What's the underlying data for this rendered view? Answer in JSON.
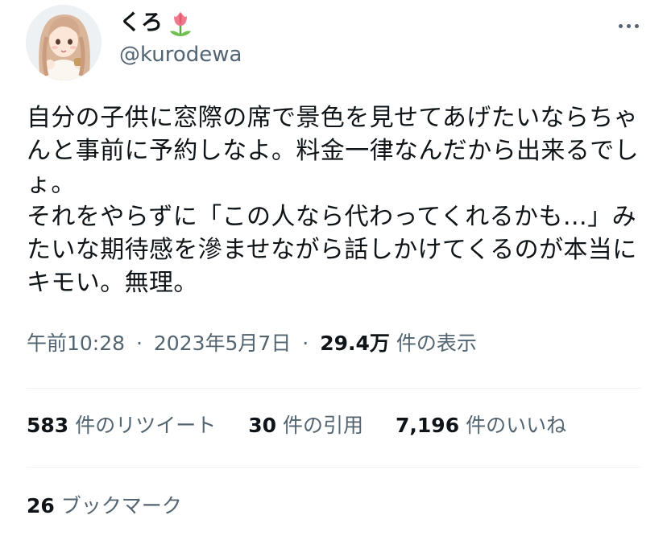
{
  "author": {
    "display_name": "くろ",
    "name_emoji": "tulip-emoji",
    "handle": "@kurodewa",
    "avatar": "avatar-illustration"
  },
  "menu": {
    "icon": "more-horizontal-icon"
  },
  "tweet": {
    "lines": [
      "自分の子供に窓際の席で景色を見せてあげたいならちゃ",
      "んと事前に予約しなよ。料金一律なんだから出来るでし",
      "ょ。",
      "それをやらずに「この人なら代わってくれるかも…」み",
      "たいな期待感を滲ませながら話しかけてくるのが本当に",
      "キモい。無理。"
    ]
  },
  "meta": {
    "time": "午前10:28",
    "separator": "·",
    "date": "2023年5月7日",
    "views_count": "29.4万",
    "views_label": "件の表示"
  },
  "stats": {
    "retweets": {
      "count": "583",
      "label": "件のリツイート"
    },
    "quotes": {
      "count": "30",
      "label": "件の引用"
    },
    "likes": {
      "count": "7,196",
      "label": "件のいいね"
    }
  },
  "bookmarks": {
    "count": "26",
    "label": "ブックマーク"
  },
  "colors": {
    "text_primary": "#0f1419",
    "text_secondary": "#536471",
    "divider": "#eff3f4"
  }
}
